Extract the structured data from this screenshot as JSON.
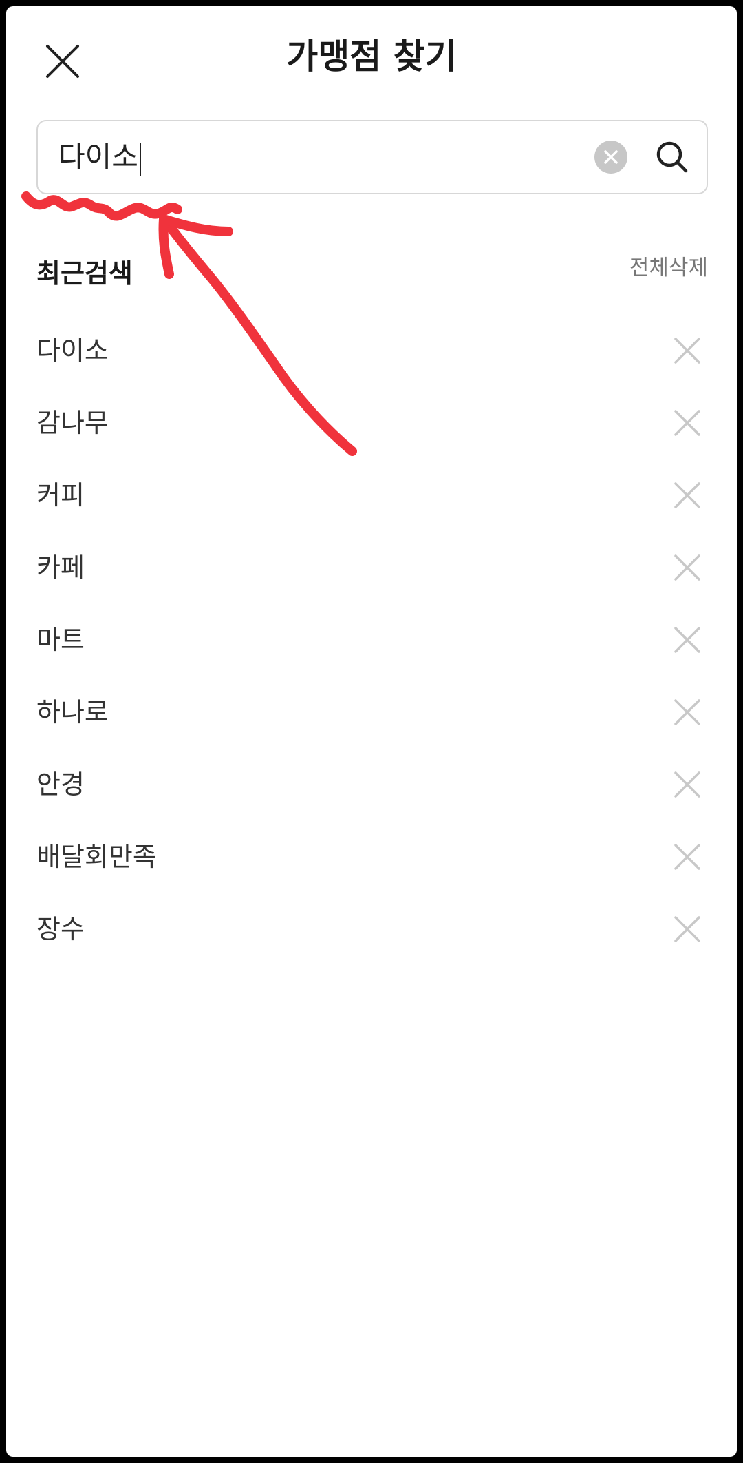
{
  "header": {
    "title": "가맹점 찾기"
  },
  "search": {
    "value": "다이소"
  },
  "recent": {
    "title": "최근검색",
    "clear_all_label": "전체삭제",
    "items": [
      {
        "label": "다이소"
      },
      {
        "label": "감나무"
      },
      {
        "label": "커피"
      },
      {
        "label": "카페"
      },
      {
        "label": "마트"
      },
      {
        "label": "하나로"
      },
      {
        "label": "안경"
      },
      {
        "label": "배달회만족"
      },
      {
        "label": "장수"
      }
    ]
  },
  "colors": {
    "annotation": "#f0333c",
    "icon_light": "#c8c8c8",
    "text_dark": "#1a1a1a"
  }
}
